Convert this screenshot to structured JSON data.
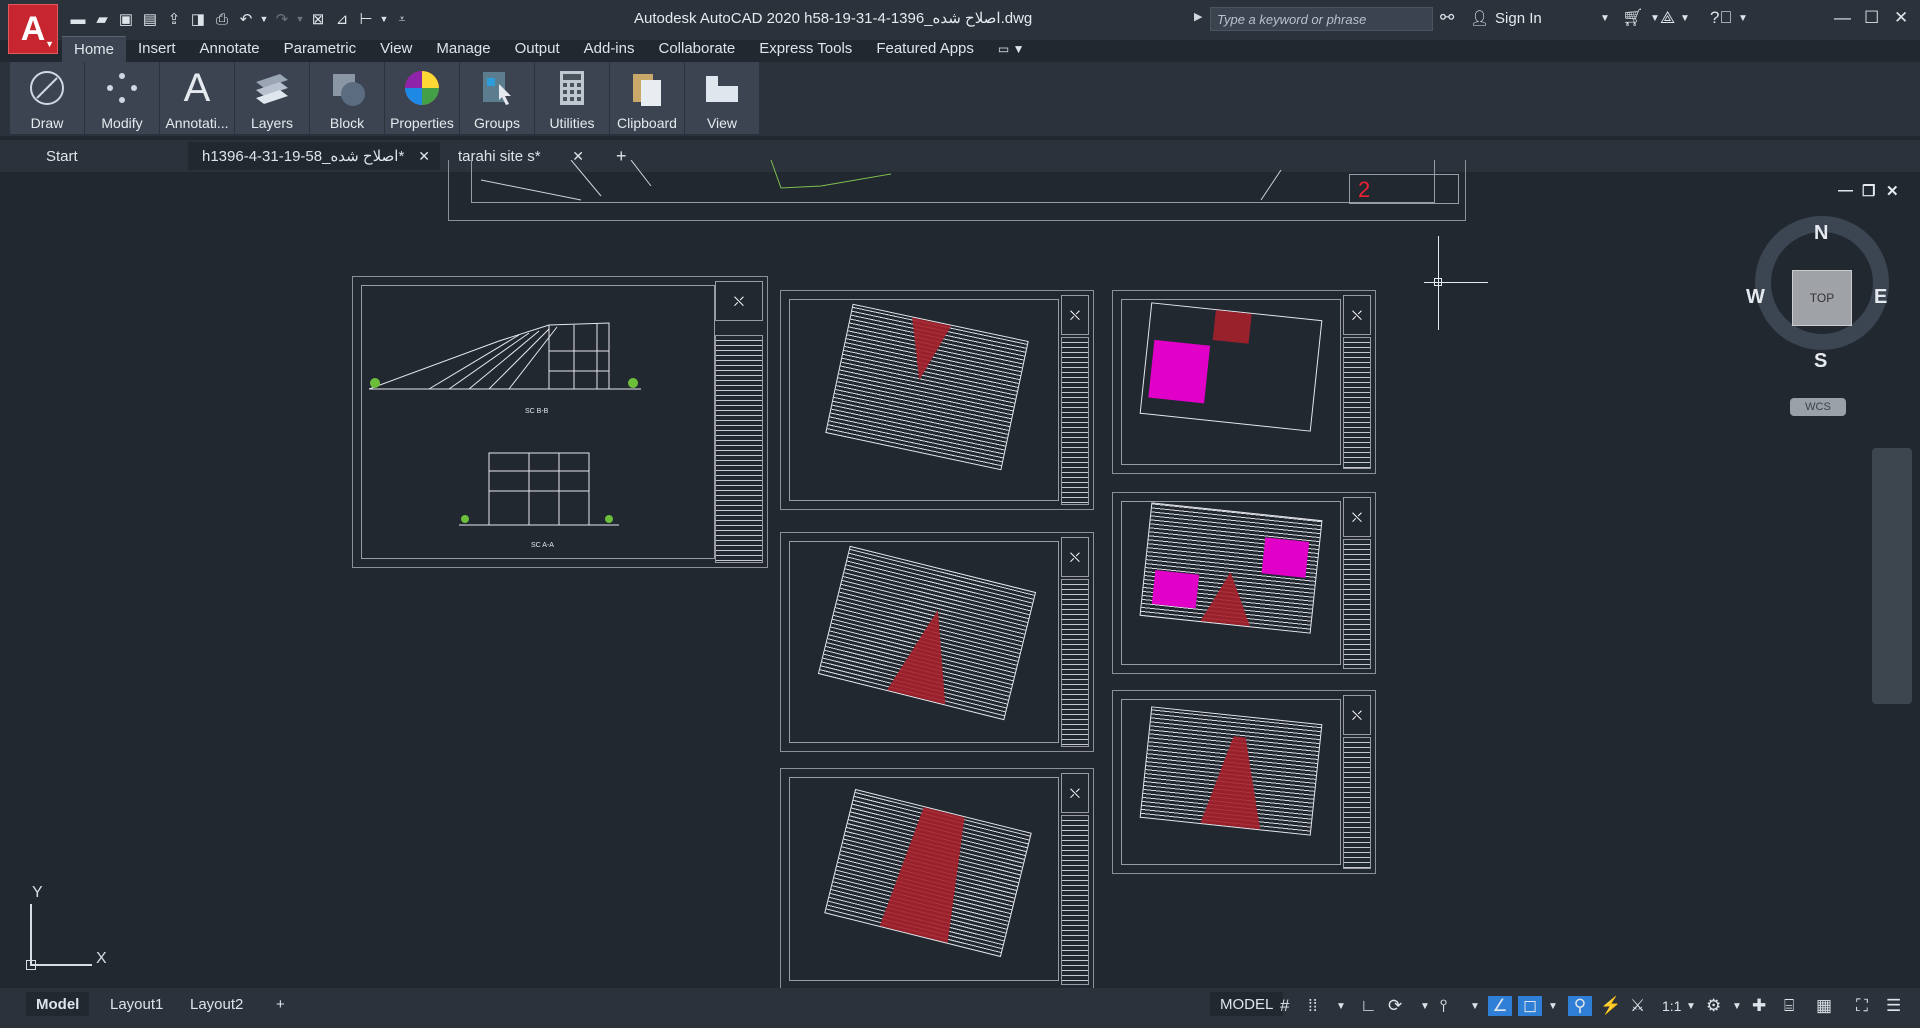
{
  "app": {
    "logo_letter": "A",
    "title": "Autodesk AutoCAD 2020    h58-19-31-4-1396_اصلاح شده.dwg"
  },
  "quick_access": [
    "new-icon",
    "open-icon",
    "save-icon",
    "saveas-icon",
    "upload-icon",
    "share-icon",
    "print-icon",
    "undo-icon",
    "redo-icon",
    "workspace-icon",
    "match-icon",
    "dimension-icon",
    "customize-icon"
  ],
  "search": {
    "placeholder": "Type a keyword or phrase"
  },
  "account": {
    "sign_in": "Sign In"
  },
  "ribbon_tabs": [
    "Home",
    "Insert",
    "Annotate",
    "Parametric",
    "View",
    "Manage",
    "Output",
    "Add-ins",
    "Collaborate",
    "Express Tools",
    "Featured Apps"
  ],
  "active_ribbon_tab": "Home",
  "panels": [
    "Draw",
    "Modify",
    "Annotati...",
    "Layers",
    "Block",
    "Properties",
    "Groups",
    "Utilities",
    "Clipboard",
    "View"
  ],
  "file_tabs": [
    {
      "label": "Start"
    },
    {
      "label": "h1396-4-31-19-58_اصلاح شده*",
      "close": "✕"
    },
    {
      "label": "tarahi site s*",
      "close": "✕"
    }
  ],
  "add_tab": "+",
  "drawing": {
    "top_number": "2",
    "section_b": "SC B-B",
    "section_a": "SC A-A",
    "sheet_number": "2"
  },
  "viewcube": {
    "top": "TOP",
    "n": "N",
    "s": "S",
    "e": "E",
    "w": "W",
    "wcs": "WCS"
  },
  "ucs": {
    "x": "X",
    "y": "Y"
  },
  "layout_tabs": [
    "Model",
    "Layout1",
    "Layout2"
  ],
  "layout_add": "+",
  "status": {
    "model": "MODEL",
    "scale": "1:1"
  }
}
